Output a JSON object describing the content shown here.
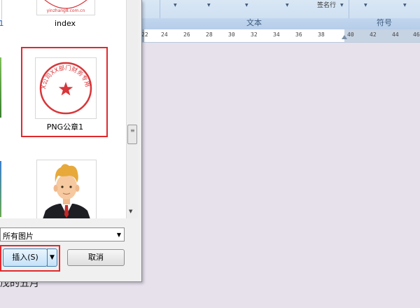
{
  "ribbon": {
    "groups": [
      {
        "caption": ""
      },
      {
        "caption": "文本"
      },
      {
        "caption": "符号"
      }
    ],
    "partial_text": "签名行"
  },
  "ruler": {
    "ticks": [
      "22",
      "24",
      "26",
      "28",
      "30",
      "32",
      "34",
      "36",
      "38",
      "40",
      "42",
      "44",
      "46"
    ]
  },
  "document": {
    "text": "茂的五月"
  },
  "dialog": {
    "files": [
      {
        "label": "index",
        "thumb_text": "yinzhang8.com.cn"
      },
      {
        "label": "PNG公章1",
        "stamp_text": "XX公司XX部门财务专用章"
      },
      {
        "label": ""
      }
    ],
    "filetype": "所有图片",
    "insert_label": "插入(S)",
    "cancel_label": "取消"
  },
  "colors": {
    "highlight": "#e0292d",
    "stamp_red": "#d8363a",
    "ribbon_caption": "#3e5a7d"
  }
}
